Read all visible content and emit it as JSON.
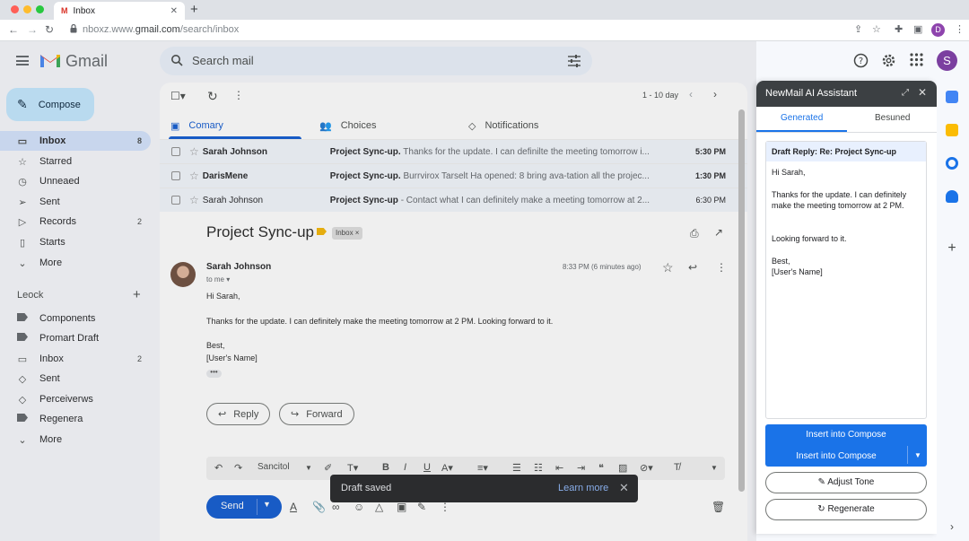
{
  "browser": {
    "tab_title": "Inbox",
    "tab_favicon": "M",
    "url_prefix": "nboxz.www.",
    "url_main": "gmail.com",
    "url_path": "/search/inbox",
    "profile_initial": "D"
  },
  "header": {
    "logo_text": "Gmail",
    "search_placeholder": "Search mail",
    "avatar_initial": "S"
  },
  "sidebar": {
    "compose_label": "Compose",
    "items": [
      {
        "icon": "inbox-icon",
        "label": "Inbox",
        "count": "8"
      },
      {
        "icon": "star-icon",
        "label": "Starred",
        "count": ""
      },
      {
        "icon": "clock-icon",
        "label": "Unneaed",
        "count": ""
      },
      {
        "icon": "send-icon",
        "label": "Sent",
        "count": ""
      },
      {
        "icon": "records-icon",
        "label": "Records",
        "count": "2"
      },
      {
        "icon": "file-icon",
        "label": "Starts",
        "count": ""
      },
      {
        "icon": "chevron-down-icon",
        "label": "More",
        "count": ""
      }
    ],
    "labels_title": "Leock",
    "labels": [
      {
        "icon": "tag-icon",
        "label": "Components",
        "count": ""
      },
      {
        "icon": "tag-icon",
        "label": "Promart Draft",
        "count": ""
      },
      {
        "icon": "inbox-icon",
        "label": "Inbox",
        "count": "2"
      },
      {
        "icon": "tag-outline-icon",
        "label": "Sent",
        "count": ""
      },
      {
        "icon": "tag-outline-icon",
        "label": "Perceiverws",
        "count": ""
      },
      {
        "icon": "tag-icon",
        "label": "Regenera",
        "count": ""
      },
      {
        "icon": "chevron-down-icon",
        "label": "More",
        "count": ""
      }
    ]
  },
  "mail_list": {
    "pager": "1 - 10 day",
    "tabs": [
      "Comary",
      "Choices",
      "Notifications"
    ],
    "rows": [
      {
        "sender": "Sarah Johnson",
        "subject": "Project Sync-up.",
        "snippet": "Thanks for the update. I can definilte the meeting tomorrow i...",
        "time": "5:30 PM",
        "unread": true
      },
      {
        "sender": "DarisMene",
        "subject": "Project Sync-up.",
        "snippet": "Burrvirox Tarselt Ha opened: 8 bring ava-tation all the projec...",
        "time": "1:30 PM",
        "unread": true
      },
      {
        "sender": "Sarah Johnson",
        "subject": "Project Sync-up",
        "snippet": "- Contact what I can definitely make a meeting tomorrow at 2...",
        "time": "6:30 PM",
        "unread": false
      }
    ]
  },
  "thread": {
    "title": "Project Sync-up",
    "label_chip": "Inbox ×",
    "from": "Sarah Johnson",
    "to": "to me ▾",
    "date": "8:33 PM (6 minutes ago)",
    "body": [
      "Hi Sarah,",
      "Thanks for the update. I can definitely make the meeting tomorrow at 2 PM. Looking forward to it.",
      "Best,",
      "[User's Name]"
    ],
    "reply_label": "Reply",
    "forward_label": "Forward"
  },
  "composer": {
    "font_name": "Sancitol",
    "send_label": "Send"
  },
  "toast": {
    "message": "Draft saved",
    "action": "Learn more"
  },
  "ai_panel": {
    "title": "NewMail AI Assistant",
    "tabs": [
      "Generated",
      "Besuned"
    ],
    "draft_heading": "Draft Reply: Re: Project Sync-up",
    "draft_lines": [
      "Hi Sarah,",
      "Thanks for the update. I can definitely make the meeting tomorrow at 2 PM.",
      "Looking forward to it.",
      "Best,",
      "[User's Name]"
    ],
    "insert_label": "Insert into Compose",
    "insert_label_2": "Insert into Compose",
    "adjust_label": "Adjust Tone",
    "regenerate_label": "Regenerate"
  },
  "colors": {
    "accent": "#0b57d0",
    "compose_bg": "#c2e7ff",
    "ai_header": "#3c4043",
    "ai_button": "#1a73e8"
  }
}
